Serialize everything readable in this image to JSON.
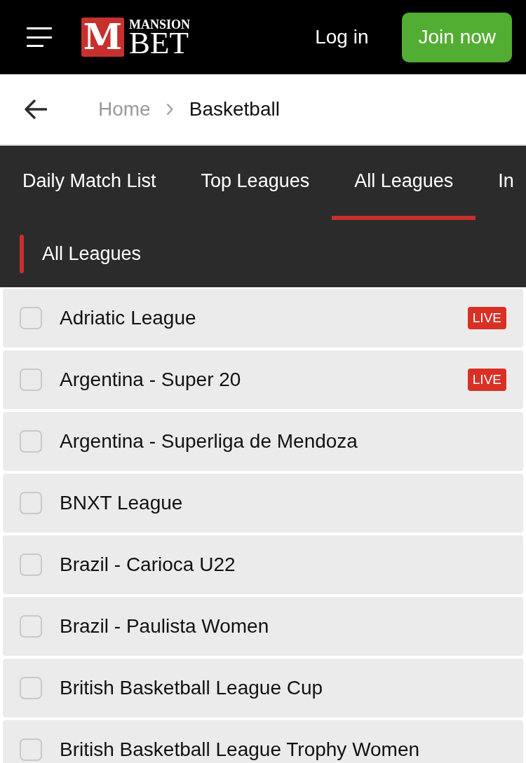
{
  "header": {
    "logo": {
      "mark": "M",
      "line_1": "MANSION",
      "line_2": "BET"
    },
    "login": "Log in",
    "join": "Join now"
  },
  "breadcrumb": [
    {
      "label": "Home",
      "current": false
    },
    {
      "label": "Basketball",
      "current": true
    }
  ],
  "tabs": [
    {
      "label": "Daily Match List",
      "selected": false
    },
    {
      "label": "Top Leagues",
      "selected": false
    },
    {
      "label": "All Leagues",
      "selected": true
    },
    {
      "label": "In",
      "selected": false
    }
  ],
  "section": {
    "title": "All Leagues"
  },
  "leagues": [
    {
      "name": "Adriatic League",
      "checked": false,
      "badge": "LIVE"
    },
    {
      "name": "Argentina - Super 20",
      "checked": false,
      "badge": "LIVE"
    },
    {
      "name": "Argentina - Superliga de Mendoza",
      "checked": false
    },
    {
      "name": "BNXT League",
      "checked": false
    },
    {
      "name": "Brazil - Carioca U22",
      "checked": false
    },
    {
      "name": "Brazil - Paulista Women",
      "checked": false
    },
    {
      "name": "British Basketball League Cup",
      "checked": false
    },
    {
      "name": "British Basketball League Trophy Women",
      "checked": false
    }
  ]
}
